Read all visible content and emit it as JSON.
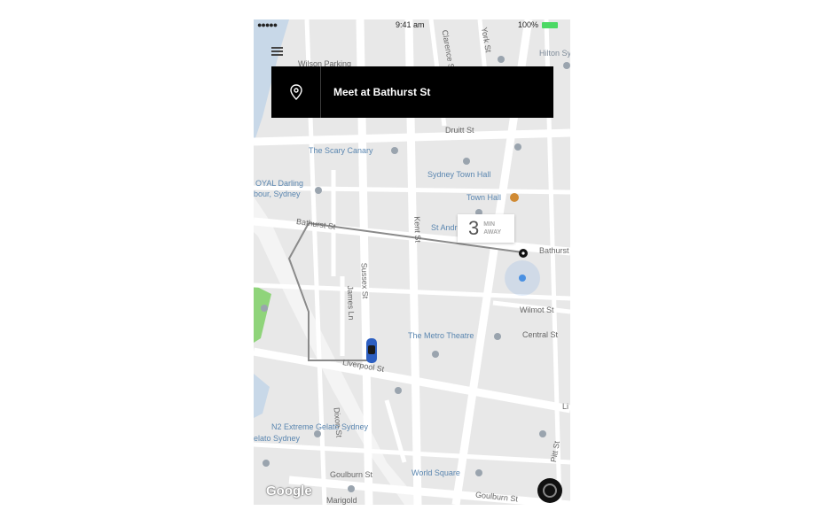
{
  "status_bar": {
    "signal": "●●●●●",
    "time": "9:41 am",
    "battery": "100%"
  },
  "pickup": {
    "label": "Meet at Bathurst St"
  },
  "eta": {
    "value": "3",
    "unit_top": "MIN",
    "unit_bottom": "AWAY"
  },
  "map": {
    "streets": [
      "Druitt St",
      "Bathurst St",
      "Bathurst",
      "Kent St",
      "Sussex St",
      "James Ln",
      "Liverpool St",
      "Goulburn St",
      "Goulburn St",
      "Wilmot St",
      "Central St",
      "Dixon St",
      "Pitt St",
      "Clarence St",
      "York St"
    ],
    "places": [
      "Hilton Sy",
      "Wilson Parking",
      "The Scary Canary",
      "Sydney Town Hall",
      "Town Hall",
      "St Andrew's Cathedral",
      "The Metro Theatre",
      "World Square",
      "N2 Extreme Gelato Sydney",
      "Marigold"
    ],
    "partial_labels": [
      "OYAL Darling",
      "bour, Sydney",
      "elato Sydney",
      "Li"
    ],
    "attribution": "Google"
  },
  "colors": {
    "banner": "#000000",
    "route": "#8a8a8a",
    "user": "#4a90e2",
    "car": "#2d5fc1",
    "park": "#8fd47a"
  }
}
